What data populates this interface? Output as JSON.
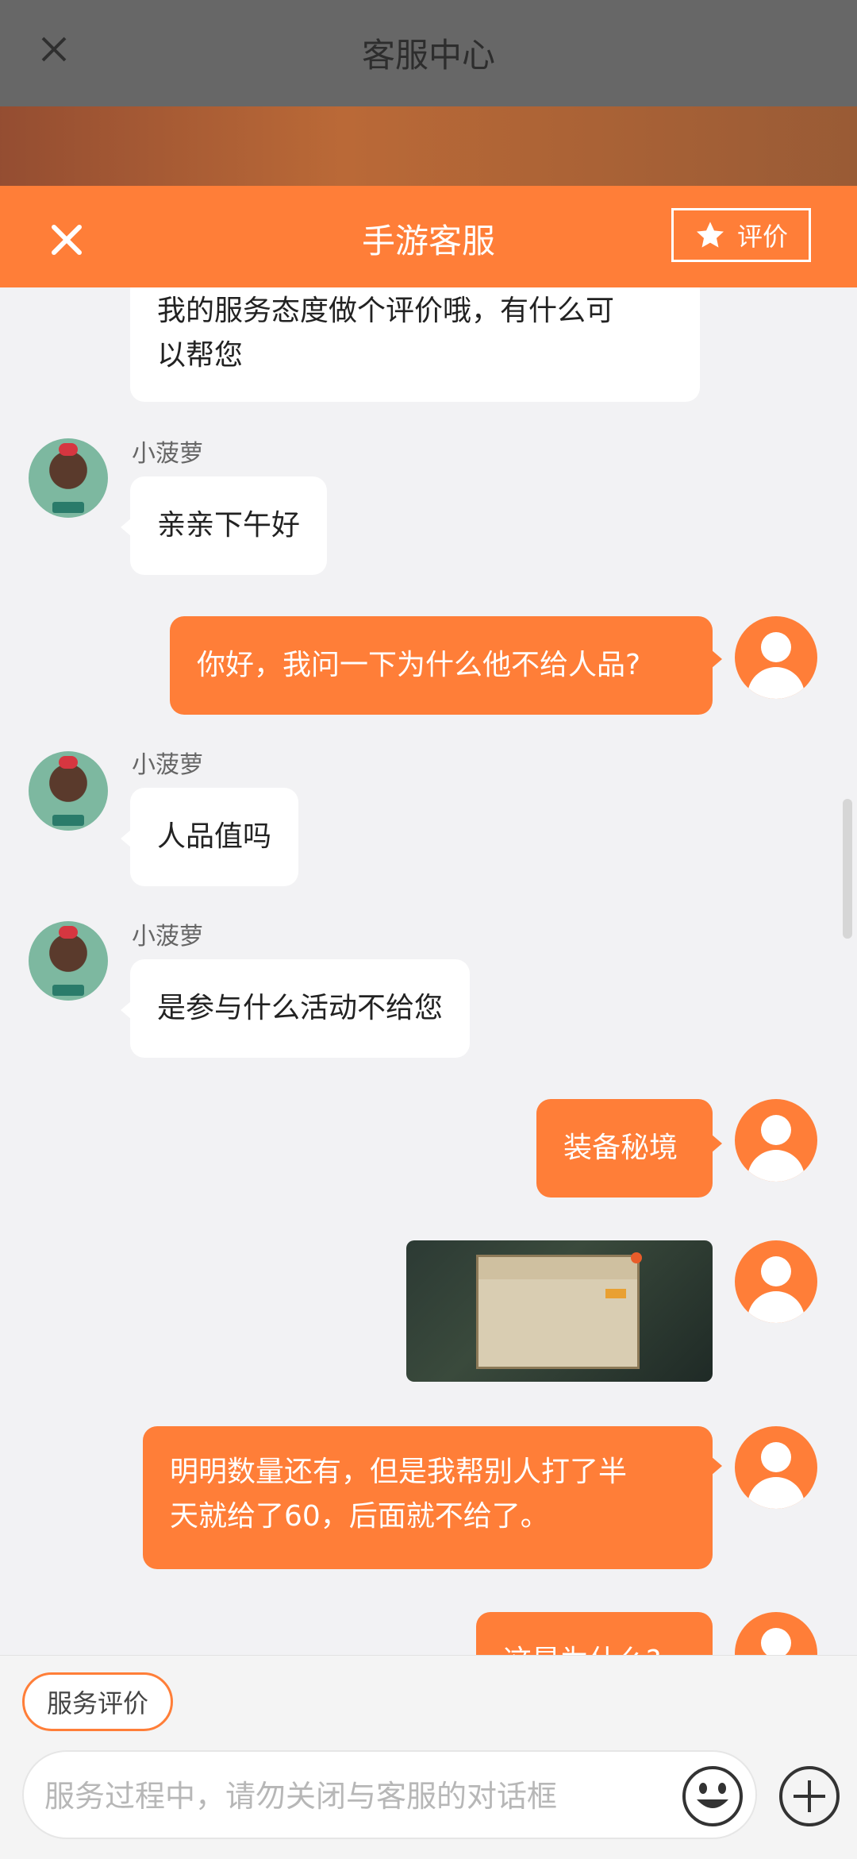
{
  "background_app": {
    "title": "客服中心"
  },
  "cs_dialog": {
    "title": "手游客服",
    "rate_label": "评价"
  },
  "messages": [
    {
      "from": "agent",
      "text_lines": [
        "我的服务态度做个评价哦，有什么可",
        "以帮您"
      ]
    },
    {
      "from": "agent",
      "name": "小菠萝",
      "text": "亲亲下午好"
    },
    {
      "from": "user",
      "text": "你好，我问一下为什么他不给人品?"
    },
    {
      "from": "agent",
      "name": "小菠萝",
      "text": "人品值吗"
    },
    {
      "from": "agent",
      "name": "小菠萝",
      "text": "是参与什么活动不给您"
    },
    {
      "from": "user",
      "text": "装备秘境"
    },
    {
      "from": "user",
      "type": "image"
    },
    {
      "from": "user",
      "text_lines": [
        "明明数量还有，但是我帮别人打了半",
        "天就给了60，后面就不给了。"
      ]
    },
    {
      "from": "user",
      "text": "这是为什么?"
    }
  ],
  "bottom_bar": {
    "service_rate_label": "服务评价",
    "input_placeholder": "服务过程中，请勿关闭与客服的对话框",
    "input_value": ""
  },
  "colors": {
    "accent": "#ff7e38",
    "bubble_agent": "#ffffff",
    "bg": "#f2f2f4"
  },
  "icons": [
    "close-icon",
    "star-icon",
    "user-avatar-icon",
    "emoji-icon",
    "plus-icon"
  ]
}
